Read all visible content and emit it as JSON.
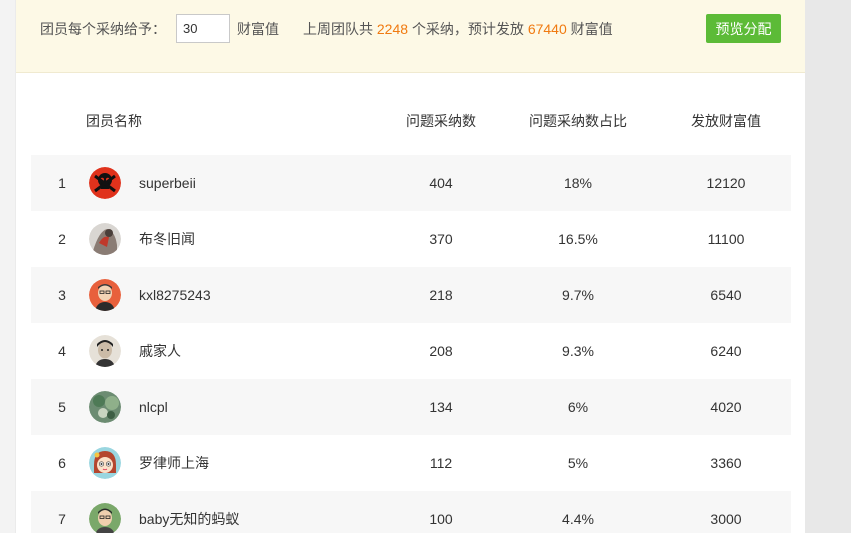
{
  "topbar": {
    "label_prefix": "团员每个采纳给予：",
    "amount_value": "30",
    "label_unit": "财富值",
    "summary_prefix": "上周团队共",
    "total_adoptions": "2248",
    "summary_mid": "个采纳，预计发放",
    "total_wealth": "67440",
    "summary_suffix": "财富值",
    "preview_button": "预览分配"
  },
  "table": {
    "headers": {
      "name": "团员名称",
      "adoptions": "问题采纳数",
      "ratio": "问题采纳数占比",
      "wealth": "发放财富值"
    },
    "rows": [
      {
        "rank": "1",
        "name": "superbeii",
        "adoptions": "404",
        "ratio": "18%",
        "wealth": "12120",
        "avatar": "skull-avatar-icon"
      },
      {
        "rank": "2",
        "name": "布冬旧闻",
        "adoptions": "370",
        "ratio": "16.5%",
        "wealth": "11100",
        "avatar": "photo-avatar"
      },
      {
        "rank": "3",
        "name": "kxl8275243",
        "adoptions": "218",
        "ratio": "9.7%",
        "wealth": "6540",
        "avatar": "photo-avatar"
      },
      {
        "rank": "4",
        "name": "戚家人",
        "adoptions": "208",
        "ratio": "9.3%",
        "wealth": "6240",
        "avatar": "photo-avatar"
      },
      {
        "rank": "5",
        "name": "nlcpl",
        "adoptions": "134",
        "ratio": "6%",
        "wealth": "4020",
        "avatar": "photo-avatar"
      },
      {
        "rank": "6",
        "name": "罗律师上海",
        "adoptions": "112",
        "ratio": "5%",
        "wealth": "3360",
        "avatar": "cartoon-avatar"
      },
      {
        "rank": "7",
        "name": "baby无知的蚂蚁",
        "adoptions": "100",
        "ratio": "4.4%",
        "wealth": "3000",
        "avatar": "photo-avatar"
      }
    ]
  },
  "colors": {
    "highlight": "#f07a10",
    "button": "#5cbb37",
    "topbar_bg": "#fdf9e6",
    "row_alt": "#f7f7f7"
  }
}
